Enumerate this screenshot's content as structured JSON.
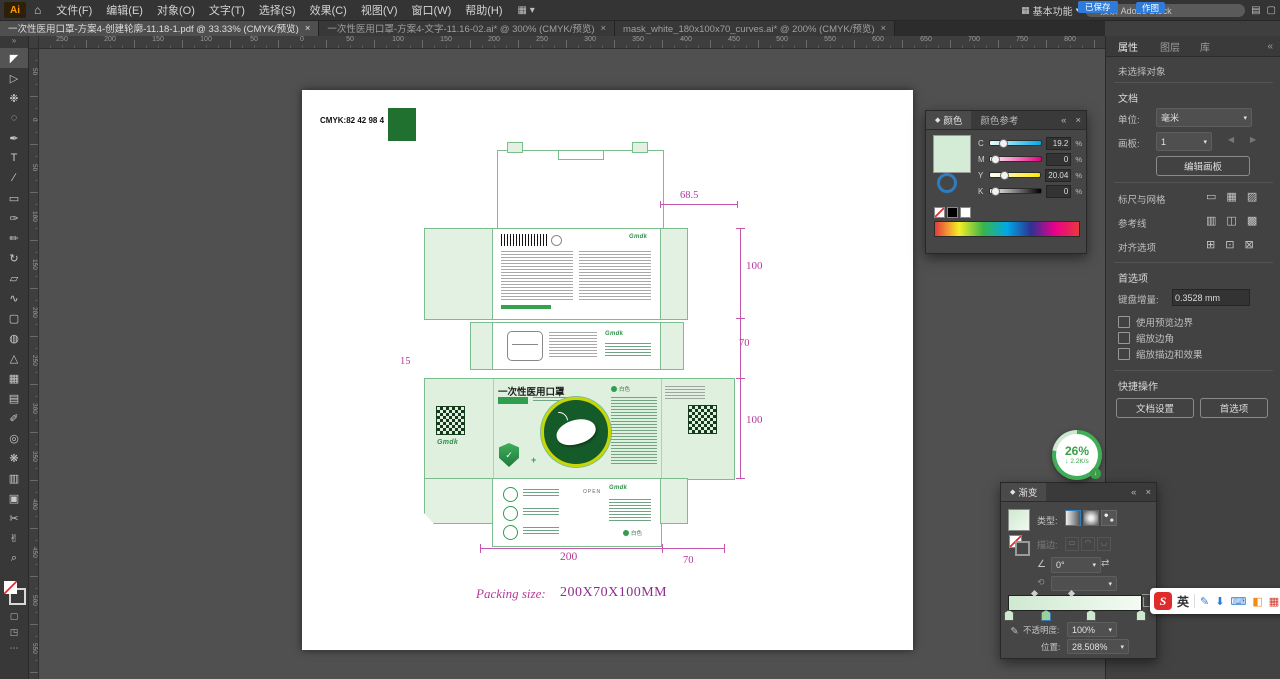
{
  "menubar": {
    "app_icon_text": "Ai",
    "menus": [
      {
        "label": "文件(F)"
      },
      {
        "label": "编辑(E)"
      },
      {
        "label": "对象(O)"
      },
      {
        "label": "文字(T)"
      },
      {
        "label": "选择(S)"
      },
      {
        "label": "效果(C)"
      },
      {
        "label": "视图(V)"
      },
      {
        "label": "窗口(W)"
      },
      {
        "label": "帮助(H)"
      }
    ],
    "plugin_buttons": [
      {
        "label": "已保存"
      },
      {
        "label": "作图"
      }
    ],
    "workspace_label": "基本功能",
    "search_placeholder": "搜索 Adobe Stock"
  },
  "tabbar": {
    "tabs": [
      {
        "title": "一次性医用口罩-方案4-创建轮廓-11.18-1.pdf @ 33.33% (CMYK/预览)",
        "close_glyph": "×"
      },
      {
        "title": "一次性医用口罩-方案4-文字-11.16-02.ai* @ 300% (CMYK/预览)",
        "close_glyph": "×"
      },
      {
        "title": "mask_white_180x100x70_curves.ai* @ 200% (CMYK/预览)",
        "close_glyph": "×"
      }
    ]
  },
  "toolbar": {
    "collapse_chevron": "»",
    "tools": [
      {
        "name": "selection-tool",
        "glyph": "◤"
      },
      {
        "name": "direct-selection-tool",
        "glyph": "▷"
      },
      {
        "name": "magic-wand-tool",
        "glyph": "❉"
      },
      {
        "name": "lasso-tool",
        "glyph": "◌"
      },
      {
        "name": "pen-tool",
        "glyph": "✒"
      },
      {
        "name": "type-tool",
        "glyph": "T"
      },
      {
        "name": "line-segment-tool",
        "glyph": "∕"
      },
      {
        "name": "rectangle-tool",
        "glyph": "▭"
      },
      {
        "name": "paintbrush-tool",
        "glyph": "✑"
      },
      {
        "name": "pencil-tool",
        "glyph": "✏"
      },
      {
        "name": "rotate-tool",
        "glyph": "↻"
      },
      {
        "name": "scale-tool",
        "glyph": "▱"
      },
      {
        "name": "width-tool",
        "glyph": "∿"
      },
      {
        "name": "free-transform-tool",
        "glyph": "▢"
      },
      {
        "name": "shape-builder-tool",
        "glyph": "◍"
      },
      {
        "name": "perspective-grid-tool",
        "glyph": "△"
      },
      {
        "name": "mesh-tool",
        "glyph": "▦"
      },
      {
        "name": "gradient-tool",
        "glyph": "▤"
      },
      {
        "name": "eyedropper-tool",
        "glyph": "✐"
      },
      {
        "name": "blend-tool",
        "glyph": "◎"
      },
      {
        "name": "symbol-sprayer-tool",
        "glyph": "❋"
      },
      {
        "name": "column-graph-tool",
        "glyph": "▥"
      },
      {
        "name": "artboard-tool",
        "glyph": "▣"
      },
      {
        "name": "slice-tool",
        "glyph": "✂"
      },
      {
        "name": "hand-tool",
        "glyph": "✌"
      },
      {
        "name": "zoom-tool",
        "glyph": "⌕"
      }
    ],
    "draw_modes": [
      {
        "name": "draw-normal-icon",
        "glyph": "▢"
      },
      {
        "name": "draw-behind-icon",
        "glyph": "◳"
      },
      {
        "name": "more-tools-icon",
        "glyph": "⋯"
      }
    ]
  },
  "rulers": {
    "top": [
      "250",
      "200",
      "150",
      "100",
      "50",
      "0",
      "50",
      "100",
      "150",
      "200",
      "250",
      "300",
      "350",
      "400",
      "450",
      "500",
      "550",
      "600",
      "650",
      "700",
      "750",
      "800"
    ],
    "left": [
      "50",
      "0",
      "50",
      "100",
      "150",
      "200",
      "250",
      "300",
      "350",
      "400",
      "450",
      "500",
      "550"
    ]
  },
  "artboard": {
    "cmyk_label": "CMYK:82 42 98 4",
    "swatch_color": "#20702f",
    "front_title": "一次性医用口罩",
    "brand": "Gmdk",
    "open_label": "OPEN",
    "white_badge": "白色",
    "plus_glyph": "+",
    "dims": {
      "top_width": "68.5",
      "back_height": "100",
      "side_height": "70",
      "front_height": "100",
      "left_tab": "15",
      "bottom_width": "200",
      "bottom_side": "70"
    },
    "packing_label": "Packing size:",
    "packing_value": "200X70X100MM"
  },
  "color_panel": {
    "tab_color": "颜色",
    "tab_guide": "颜色参考",
    "collapse": "«",
    "close": "×",
    "swatch_color": "#d4ebd5",
    "sliders": [
      {
        "ch": "C",
        "value": "19.2",
        "unit": "%",
        "knob_left": "19.2%",
        "track_css": "linear-gradient(to right,#eafffb,#00a8e8)"
      },
      {
        "ch": "M",
        "value": "0",
        "unit": "%",
        "knob_left": "2%",
        "track_css": "linear-gradient(to right,#ffffff,#e6007e)"
      },
      {
        "ch": "Y",
        "value": "20.04",
        "unit": "%",
        "knob_left": "20%",
        "track_css": "linear-gradient(to right,#ffffff,#ffe800)"
      },
      {
        "ch": "K",
        "value": "0",
        "unit": "%",
        "knob_left": "2%",
        "track_css": "linear-gradient(to right,#ffffff,#000000)"
      }
    ],
    "spectrum_css": "linear-gradient(to right,#e8383d,#f6ee26,#3ab54a,#00a8e8,#2e3192,#ec008c,#e8383d)"
  },
  "gradient_panel": {
    "title": "渐变",
    "collapse": "«",
    "close": "×",
    "type_label": "类型:",
    "stroke_label": "描边:",
    "angle_value": "0°",
    "opacity_label": "不透明度:",
    "opacity_value": "100%",
    "position_label": "位置:",
    "position_value": "28.508%",
    "swatch_css": "linear-gradient(135deg,#cfe9cf,#f1f9f1)",
    "gradient_css": "linear-gradient(to right,#cfe9cf,#f4fbf4)",
    "stop_positions": [
      "0%",
      "28%",
      "62%",
      "100%"
    ]
  },
  "properties": {
    "tabs": [
      {
        "label": "属性"
      },
      {
        "label": "图层"
      },
      {
        "label": "库"
      }
    ],
    "collapse": "«",
    "no_selection": "未选择对象",
    "doc_section": "文档",
    "unit_label": "单位:",
    "unit_value": "毫米",
    "artboard_label": "画板:",
    "artboard_value": "1",
    "edit_artboard_btn": "编辑画板",
    "ruler_grid_label": "标尺与网格",
    "ruler_grid_icons": [
      {
        "name": "ruler-icon",
        "glyph": "▭"
      },
      {
        "name": "grid-icon",
        "glyph": "▦"
      },
      {
        "name": "transparency-grid-icon",
        "glyph": "▨"
      }
    ],
    "guides_label": "参考线",
    "guides_icons": [
      {
        "name": "show-guides-icon",
        "glyph": "▥"
      },
      {
        "name": "lock-guides-icon",
        "glyph": "◫"
      },
      {
        "name": "smart-guides-icon",
        "glyph": "▩"
      }
    ],
    "snap_label": "对齐选项",
    "snap_icons": [
      {
        "name": "snap-grid-icon",
        "glyph": "⊞"
      },
      {
        "name": "snap-point-icon",
        "glyph": "⊡"
      },
      {
        "name": "snap-pixel-icon",
        "glyph": "⊠"
      }
    ],
    "prefs_section": "首选项",
    "keyboard_label": "键盘增量:",
    "keyboard_value": "0.3528 mm",
    "checkboxes": [
      {
        "label": "使用预览边界"
      },
      {
        "label": "缩放边角"
      },
      {
        "label": "缩放描边和效果"
      }
    ],
    "quick_section": "快捷操作",
    "doc_setup_btn": "文档设置",
    "prefs_btn": "首选项"
  },
  "badge": {
    "percent": "26%",
    "arrow": "↓",
    "speed": "2.2K/s"
  },
  "ime": {
    "logo": "S",
    "mode": "英",
    "icons": [
      {
        "name": "pen-icon",
        "glyph": "✎",
        "color": "#2f7bd9"
      },
      {
        "name": "download-icon",
        "glyph": "⬇",
        "color": "#2f7bd9"
      },
      {
        "name": "keyboard-icon",
        "glyph": "⌨",
        "color": "#2f7bd9"
      },
      {
        "name": "skin-icon",
        "glyph": "◧",
        "color": "#f08c1e"
      },
      {
        "name": "grid-icon",
        "glyph": "▦",
        "color": "#d23a2e"
      }
    ]
  }
}
